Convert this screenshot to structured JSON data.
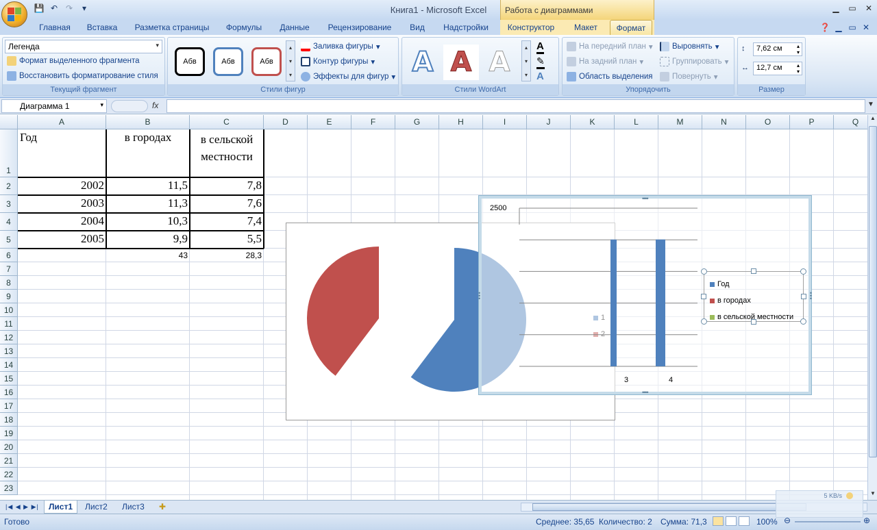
{
  "window": {
    "title": "Книга1 - Microsoft Excel",
    "context_tools": "Работа с диаграммами"
  },
  "ribbon_tabs": [
    "Главная",
    "Вставка",
    "Разметка страницы",
    "Формулы",
    "Данные",
    "Рецензирование",
    "Вид",
    "Надстройки",
    "Конструктор",
    "Макет",
    "Формат"
  ],
  "current_fragment": {
    "select_value": "Легенда",
    "format_selection": "Формат выделенного фрагмента",
    "reset_style": "Восстановить форматирование стиля",
    "label": "Текущий фрагмент"
  },
  "shape_styles": {
    "sample": "Абв",
    "fill": "Заливка фигуры",
    "outline": "Контур фигуры",
    "effects": "Эффекты для фигур",
    "label": "Стили фигур"
  },
  "wordart": {
    "glyph": "A",
    "label": "Стили WordArt"
  },
  "arrange": {
    "bring_front": "На передний план",
    "send_back": "На задний план",
    "selection_pane": "Область выделения",
    "align": "Выровнять",
    "group": "Группировать",
    "rotate": "Повернуть",
    "label": "Упорядочить"
  },
  "size": {
    "height": "7,62 см",
    "width": "12,7 см",
    "label": "Размер"
  },
  "formula_bar": {
    "name_box": "Диаграмма 1",
    "fx": "fx",
    "formula": ""
  },
  "columns": [
    "A",
    "B",
    "C",
    "D",
    "E",
    "F",
    "G",
    "H",
    "I",
    "J",
    "K",
    "L",
    "M",
    "N",
    "O",
    "P",
    "Q"
  ],
  "rows": [
    "1",
    "2",
    "3",
    "4",
    "5",
    "6",
    "7",
    "8",
    "9",
    "10",
    "11",
    "12",
    "13",
    "14",
    "15",
    "16",
    "17",
    "18",
    "19",
    "20",
    "21",
    "22",
    "23"
  ],
  "table": {
    "headers": [
      "Год",
      "в городах",
      "в сельской местности"
    ],
    "header_c_line1": "в сельской",
    "header_c_line2": "местности",
    "data": [
      [
        "2002",
        "11,5",
        "7,8"
      ],
      [
        "2003",
        "11,3",
        "7,6"
      ],
      [
        "2004",
        "10,3",
        "7,4"
      ],
      [
        "2005",
        "9,9",
        "5,5"
      ]
    ],
    "totals": [
      "43",
      "28,3"
    ]
  },
  "chart_data": [
    {
      "type": "pie",
      "series": [
        {
          "name": "",
          "values": [
            43,
            28.3
          ]
        }
      ],
      "categories": [
        "1",
        "2"
      ],
      "legend": [
        "1",
        "2"
      ],
      "colors": [
        "#4f81bd",
        "#c0504d"
      ],
      "legend_position": "right"
    },
    {
      "type": "bar",
      "categories": [
        "3",
        "4"
      ],
      "series": [
        {
          "name": "Год",
          "values": [
            2004,
            2005
          ]
        }
      ],
      "ytick_top": "2500",
      "legend": [
        "Год",
        "в городах",
        "в сельской местности"
      ],
      "colors": [
        "#4f81bd",
        "#c0504d",
        "#9bbb59"
      ],
      "ylim": [
        0,
        2500
      ],
      "legend_position": "right"
    }
  ],
  "sheets": [
    "Лист1",
    "Лист2",
    "Лист3"
  ],
  "status": {
    "ready": "Готово",
    "average": "Среднее: 35,65",
    "count": "Количество: 2",
    "sum": "Сумма: 71,3",
    "zoom": "100%",
    "net_speed": "5 KB/s"
  }
}
